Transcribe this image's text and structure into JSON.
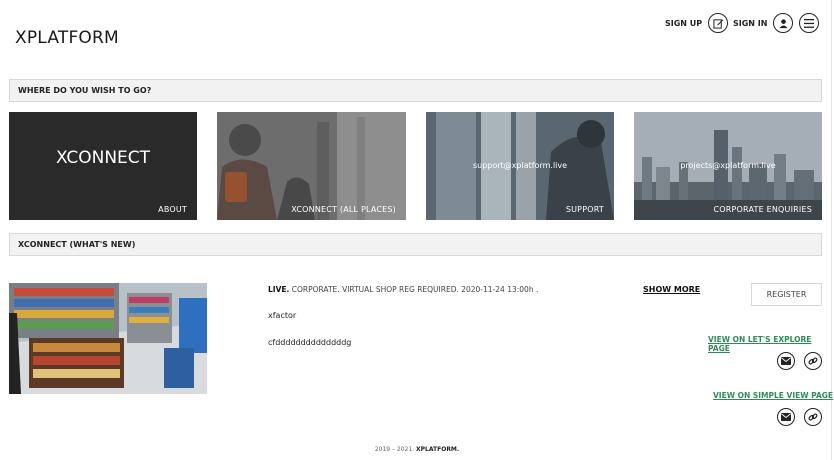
{
  "header": {
    "logo": "XPLATFORM",
    "signup_label": "SIGN UP",
    "signin_label": "SIGN IN"
  },
  "sections": {
    "destinations_title": "WHERE DO YOU WISH TO GO?",
    "news_title": "XCONNECT (WHAT'S NEW)"
  },
  "tiles": [
    {
      "title": "XCONNECT",
      "label": "ABOUT"
    },
    {
      "label": "XCONNECT (ALL PLACES)"
    },
    {
      "email": "support@xplatform.live",
      "label": "SUPPORT"
    },
    {
      "email": "projects@xplatform.live",
      "label": "CORPORATE ENQUIRIES"
    }
  ],
  "news": {
    "status": "LIVE.",
    "meta": " CORPORATE. VIRTUAL SHOP REG REQUIRED. 2020-11-24 13:00h .",
    "title": "xfactor",
    "description": "cfddddddddddddddg",
    "show_more": "SHOW MORE",
    "register": "REGISTER",
    "link_explore": "VIEW ON LET'S EXPLORE PAGE",
    "link_simple": "VIEW ON SIMPLE VIEW PAGE"
  },
  "footer": {
    "years": "2019 – 2021.",
    "brand": "XPLATFORM."
  },
  "colors": {
    "link_green": "#2e8b57",
    "tile_dark": "#2a2a2a",
    "bar_bg": "#f2f2f2"
  },
  "icons": [
    "edit-icon",
    "user-icon",
    "menu-icon",
    "mail-icon",
    "link-icon"
  ]
}
